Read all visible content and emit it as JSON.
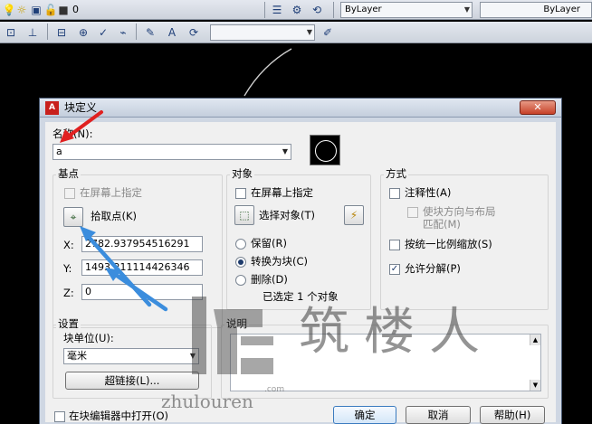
{
  "toolbar_top": {
    "layer_value": "0",
    "linetype_value": "ByLayer",
    "lineweight_value": "ByLayer"
  },
  "dialog": {
    "title": "块定义",
    "close_label": "✕",
    "name_label": "名称(N):",
    "name_value": "a",
    "base_point": {
      "title": "基点",
      "specify_on_screen": "在屏幕上指定",
      "pick_point": "拾取点(K)",
      "x_label": "X:",
      "x_value": "2782.937954516291",
      "y_label": "Y:",
      "y_value": "1493.211114426346",
      "z_label": "Z:",
      "z_value": "0"
    },
    "objects": {
      "title": "对象",
      "specify_on_screen": "在屏幕上指定",
      "select_objects": "选择对象(T)",
      "retain": "保留(R)",
      "convert_to_block": "转换为块(C)",
      "delete": "删除(D)",
      "selected_count": "已选定 1 个对象"
    },
    "behavior": {
      "title": "方式",
      "annotative": "注释性(A)",
      "match_orientation_line1": "使块方向与布局",
      "match_orientation_line2": "匹配(M)",
      "scale_uniformly": "按统一比例缩放(S)",
      "allow_exploding": "允许分解(P)"
    },
    "settings": {
      "title": "设置",
      "block_unit_label": "块单位(U):",
      "block_unit_value": "毫米",
      "hyperlink_button": "超链接(L)..."
    },
    "description": {
      "title": "说明"
    },
    "open_in_editor": "在块编辑器中打开(O)",
    "ok_button": "确定",
    "cancel_button": "取消",
    "help_button": "帮助(H)"
  },
  "watermark": {
    "cn_text": "筑楼人",
    "pinyin": "zhulouren",
    "dot_com": ".com"
  }
}
